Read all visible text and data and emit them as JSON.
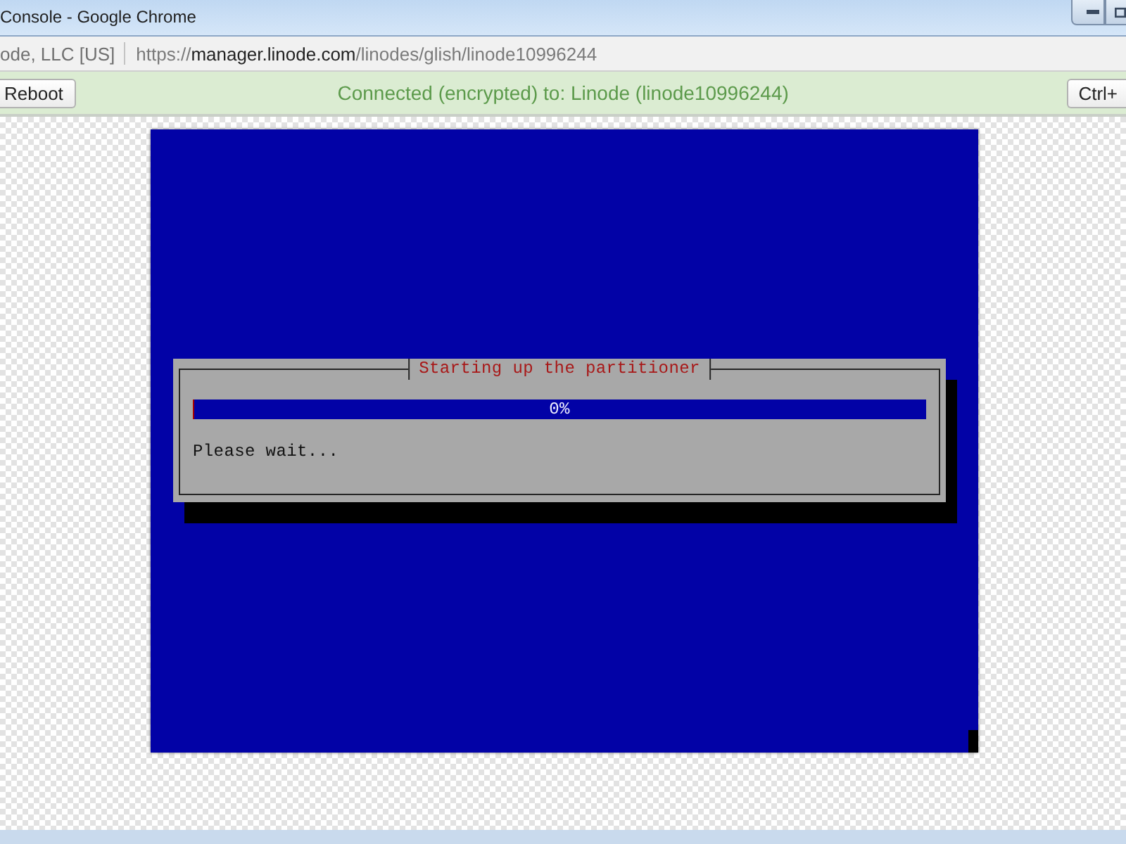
{
  "window": {
    "title": "Console - Google Chrome"
  },
  "address_bar": {
    "site_identity": "ode, LLC [US]",
    "url": {
      "scheme": "https://",
      "host": "manager.linode.com",
      "path": "/linodes/glish/linode10996244"
    }
  },
  "toolbar": {
    "left_button": "Reboot",
    "status": "Connected (encrypted) to: Linode (linode10996244)",
    "right_button": "Ctrl+"
  },
  "console": {
    "dialog": {
      "title": "Starting up the partitioner",
      "progress": {
        "level": 0,
        "reading": "0%"
      },
      "message": "Please wait..."
    }
  }
}
